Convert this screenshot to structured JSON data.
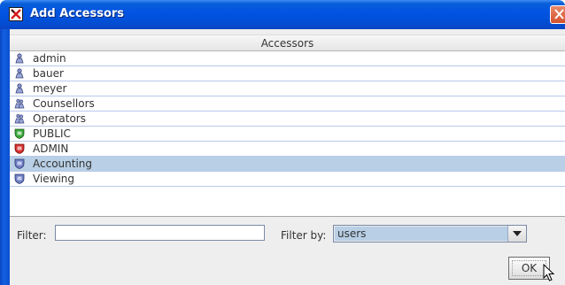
{
  "window": {
    "title": "Add Accessors"
  },
  "table": {
    "header": "Accessors",
    "rows": [
      {
        "label": "admin",
        "icon": "user-icon"
      },
      {
        "label": "bauer",
        "icon": "user-icon"
      },
      {
        "label": "meyer",
        "icon": "user-icon"
      },
      {
        "label": "Counsellors",
        "icon": "group-icon"
      },
      {
        "label": "Operators",
        "icon": "group-icon"
      },
      {
        "label": "PUBLIC",
        "icon": "green-shield-icon"
      },
      {
        "label": "ADMIN",
        "icon": "red-shield-icon"
      },
      {
        "label": "Accounting",
        "icon": "blue-shield-icon",
        "selected": true
      },
      {
        "label": "Viewing",
        "icon": "blue-shield-icon"
      }
    ]
  },
  "filter": {
    "label": "Filter:",
    "value": ""
  },
  "filter_by": {
    "label": "Filter by:",
    "selected": "users"
  },
  "buttons": {
    "ok": "OK"
  },
  "colors": {
    "title_bar": "#0154e3",
    "selection": "#b8cfe5",
    "row_divider": "#b9c9ea"
  }
}
